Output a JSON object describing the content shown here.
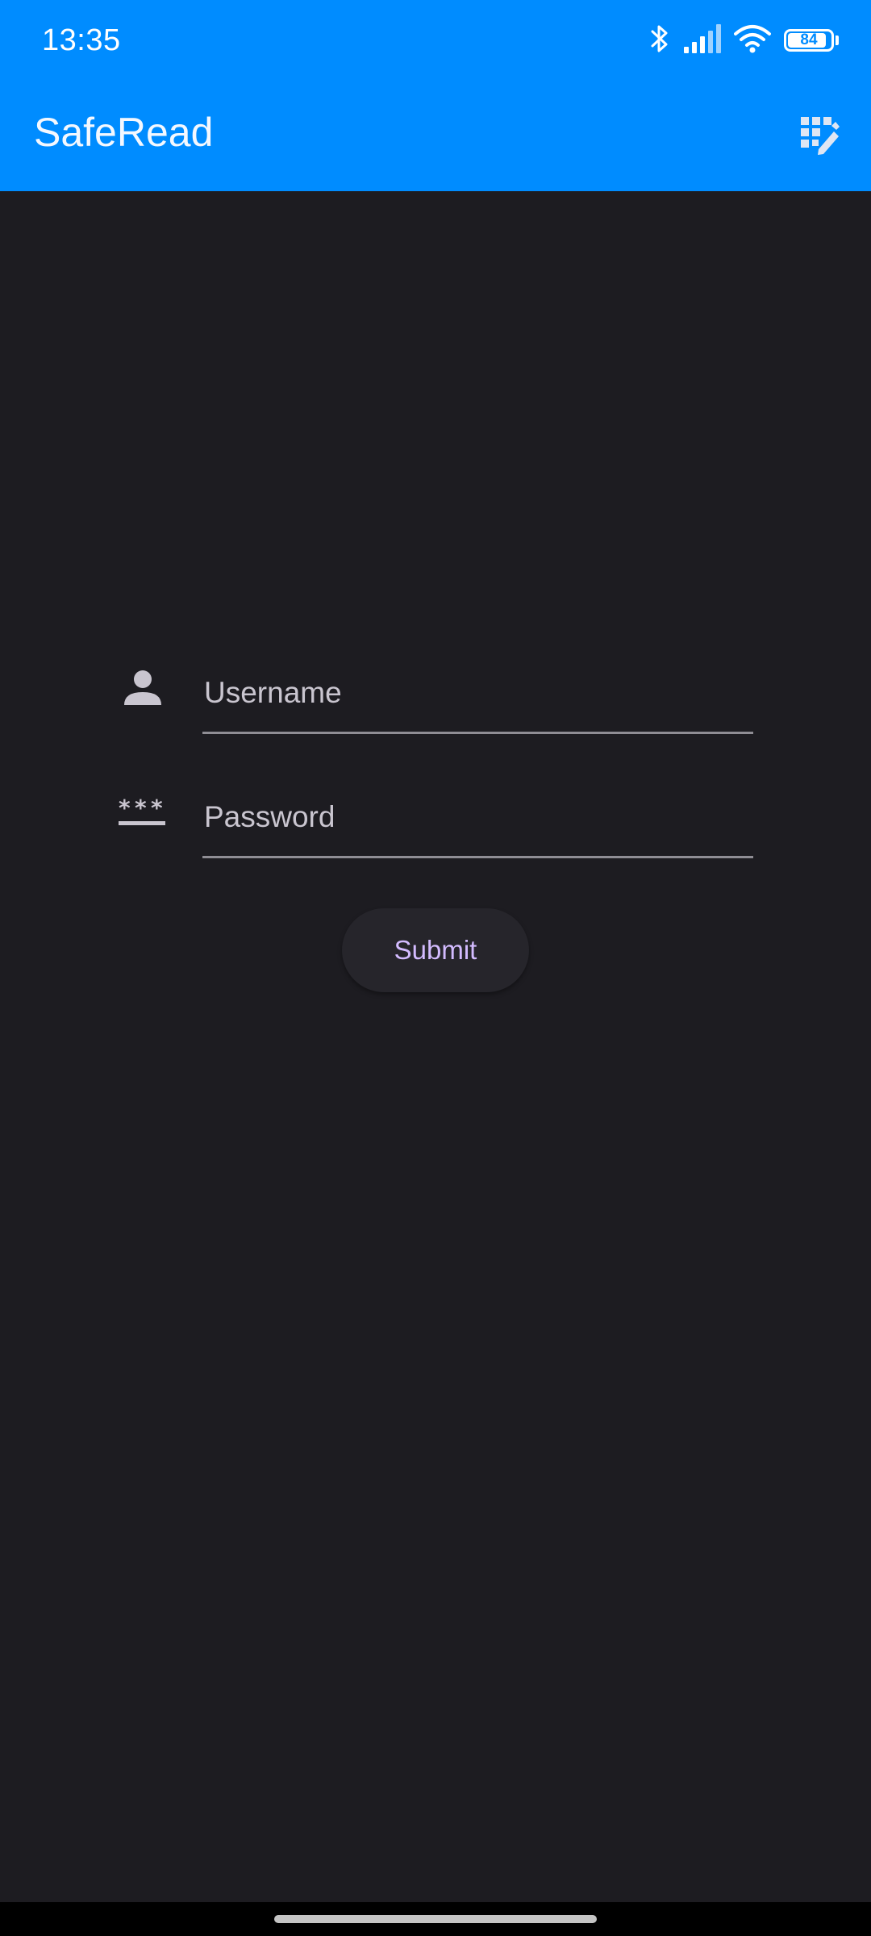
{
  "status_bar": {
    "time": "13:35",
    "battery_level": "84",
    "icons": [
      "bluetooth-icon",
      "signal-icon",
      "wifi-icon",
      "battery-icon"
    ]
  },
  "app_bar": {
    "title": "SafeRead",
    "action_icon": "qr-scan-edit-icon"
  },
  "form": {
    "username": {
      "placeholder": "Username",
      "value": "",
      "icon": "person-icon"
    },
    "password": {
      "placeholder": "Password",
      "value": "",
      "icon": "password-icon"
    },
    "submit_label": "Submit"
  },
  "colors": {
    "app_bar": "#008cff",
    "background": "#1d1c21",
    "accent_text": "#d3bbff"
  }
}
